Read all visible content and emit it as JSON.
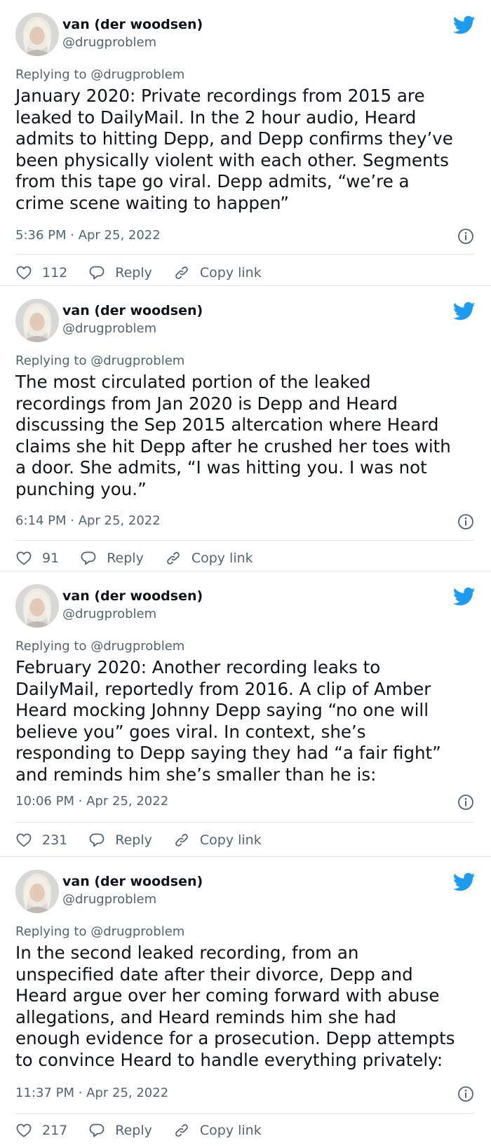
{
  "tweets": [
    {
      "author_name": "van (der woodsen)",
      "author_handle": "@drugproblem",
      "replying_to": "Replying to @drugproblem",
      "body_lines": [
        "January 2020: Private recordings from 2015 are",
        "leaked to DailyMail. In the 2 hour audio, Heard",
        "admits to hitting Depp, and Depp confirms they’ve",
        "been physically violent with each other. Segments",
        "from this tape go viral. Depp admits, “we’re a",
        "crime scene waiting to happen”"
      ],
      "timestamp": "5:36 PM · Apr 25, 2022",
      "likes": "112",
      "reply_label": "Reply",
      "copy_label": "Copy link"
    },
    {
      "author_name": "van (der woodsen)",
      "author_handle": "@drugproblem",
      "replying_to": "Replying to @drugproblem",
      "body_lines": [
        "The most circulated portion of the leaked",
        "recordings from Jan 2020 is Depp and Heard",
        "discussing the Sep 2015 altercation where Heard",
        "claims she hit Depp after he crushed her toes with",
        "a door. She admits, “I was hitting you. I was not",
        "punching you.”"
      ],
      "timestamp": "6:14 PM · Apr 25, 2022",
      "likes": "91",
      "reply_label": "Reply",
      "copy_label": "Copy link"
    },
    {
      "author_name": "van (der woodsen)",
      "author_handle": "@drugproblem",
      "replying_to": "Replying to @drugproblem",
      "body_lines": [
        "February 2020: Another recording leaks to",
        "DailyMail, reportedly from 2016. A clip of Amber",
        "Heard mocking Johnny Depp saying “no one will",
        "believe you” goes viral. In context, she’s",
        "responding to Depp saying they had “a fair fight”",
        "and reminds him she’s smaller than he is:"
      ],
      "timestamp": "10:06 PM · Apr 25, 2022",
      "likes": "231",
      "reply_label": "Reply",
      "copy_label": "Copy link"
    },
    {
      "author_name": "van (der woodsen)",
      "author_handle": "@drugproblem",
      "replying_to": "Replying to @drugproblem",
      "body_lines": [
        "In the second leaked recording, from an",
        "unspecified date after their divorce, Depp and",
        "Heard argue over her coming forward with abuse",
        "allegations, and Heard reminds him she had",
        "enough evidence for a prosecution. Depp attempts",
        "to convince Heard to handle everything privately:"
      ],
      "timestamp": "11:37 PM · Apr 25, 2022",
      "likes": "217",
      "reply_label": "Reply",
      "copy_label": "Copy link"
    }
  ],
  "colors": {
    "twitter_blue": "#1d9bf0",
    "text_primary": "#0f1419",
    "text_secondary": "#536471",
    "divider": "#e1e8ed"
  },
  "icons": [
    "twitter-bird-icon",
    "info-icon",
    "heart-icon",
    "reply-icon",
    "copy-link-icon"
  ]
}
